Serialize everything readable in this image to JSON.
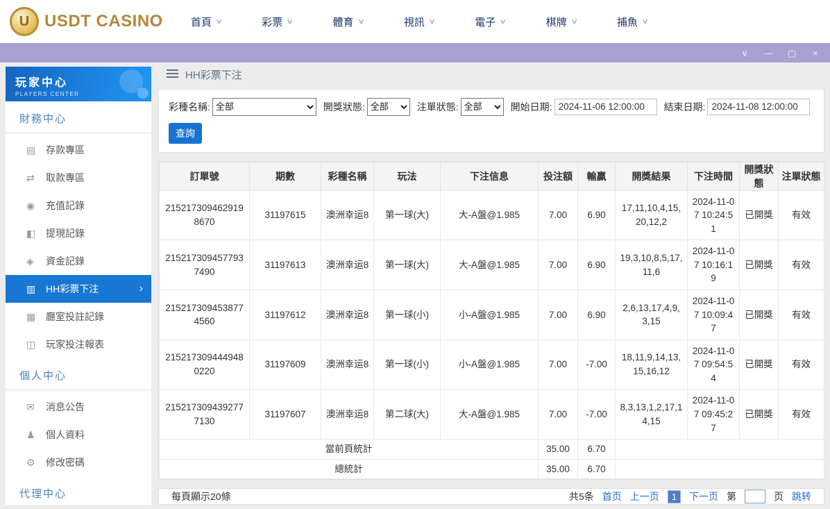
{
  "app": {
    "logo_text": "USDT CASINO",
    "logo_monogram": "U"
  },
  "nav": {
    "items": [
      {
        "label": "首頁"
      },
      {
        "label": "彩票"
      },
      {
        "label": "體育"
      },
      {
        "label": "視訊"
      },
      {
        "label": "電子"
      },
      {
        "label": "棋牌"
      },
      {
        "label": "捕魚"
      }
    ]
  },
  "window_controls": {
    "chevron": "∨",
    "minimize": "—",
    "maximize": "▢",
    "close": "×"
  },
  "icons": {
    "nav_chevron": "∨",
    "active_chevron": "›"
  },
  "colors": {
    "accent_blue": "#1673d2",
    "titlebar_purple": "#a7a1d1",
    "sidebar_header_blue": "#1e88e5",
    "link_blue": "#2b6cd4"
  },
  "sidebar": {
    "title": "玩家中心",
    "subtitle": "PLAYERS CENTER",
    "sections": [
      {
        "heading": "財務中心",
        "items": [
          {
            "label": "存款專區",
            "icon": "▤"
          },
          {
            "label": "取款專區",
            "icon": "⇄"
          },
          {
            "label": "充值記錄",
            "icon": "◉"
          },
          {
            "label": "提現記錄",
            "icon": "◧"
          },
          {
            "label": "資金記錄",
            "icon": "◈"
          },
          {
            "label": "HH彩票下注",
            "icon": "▥"
          },
          {
            "label": "廳室投註記錄",
            "icon": "▦"
          },
          {
            "label": "玩家投注報表",
            "icon": "◫"
          }
        ]
      },
      {
        "heading": "個人中心",
        "items": [
          {
            "label": "消息公告",
            "icon": "✉"
          },
          {
            "label": "個人資料",
            "icon": "♟"
          },
          {
            "label": "修改密碼",
            "icon": "⚙"
          }
        ]
      },
      {
        "heading": "代理中心",
        "items": []
      }
    ]
  },
  "breadcrumb": {
    "title": "HH彩票下注"
  },
  "filters": {
    "lottery_name": {
      "label": "彩種名稱:",
      "value": "全部"
    },
    "draw_status": {
      "label": "開獎狀態:",
      "value": "全部"
    },
    "order_status": {
      "label": "注單狀態:",
      "value": "全部"
    },
    "start_date": {
      "label": "開始日期:",
      "value": "2024-11-06 12:00:00"
    },
    "end_date": {
      "label": "結束日期:",
      "value": "2024-11-08 12:00:00"
    },
    "search_button": "查詢"
  },
  "table": {
    "headers": [
      "訂單號",
      "期數",
      "彩種名稱",
      "玩法",
      "下注信息",
      "投注額",
      "輸贏",
      "開獎結果",
      "下注時間",
      "開獎狀態",
      "注單狀態"
    ],
    "rows": [
      [
        "2152173094629198670",
        "31197615",
        "澳洲幸运8",
        "第一球(大)",
        "大-A盤@1.985",
        "7.00",
        "6.90",
        "17,11,10,4,15,20,12,2",
        "2024-11-07 10:24:51",
        "已開獎",
        "有效"
      ],
      [
        "2152173094577937490",
        "31197613",
        "澳洲幸运8",
        "第一球(大)",
        "大-A盤@1.985",
        "7.00",
        "6.90",
        "19,3,10,8,5,17,11,6",
        "2024-11-07 10:16:19",
        "已開獎",
        "有效"
      ],
      [
        "2152173094538774560",
        "31197612",
        "澳洲幸运8",
        "第一球(小)",
        "小-A盤@1.985",
        "7.00",
        "6.90",
        "2,6,13,17,4,9,3,15",
        "2024-11-07 10:09:47",
        "已開獎",
        "有效"
      ],
      [
        "2152173094449480220",
        "31197609",
        "澳洲幸运8",
        "第一球(小)",
        "小-A盤@1.985",
        "7.00",
        "-7.00",
        "18,11,9,14,13,15,16,12",
        "2024-11-07 09:54:54",
        "已開獎",
        "有效"
      ],
      [
        "2152173094392777130",
        "31197607",
        "澳洲幸运8",
        "第二球(大)",
        "大-A盤@1.985",
        "7.00",
        "-7.00",
        "8,3,13,1,2,17,14,15",
        "2024-11-07 09:45:27",
        "已開獎",
        "有效"
      ]
    ],
    "summary_rows": [
      {
        "label": "當前頁統計",
        "bet": "35.00",
        "winloss": "6.70"
      },
      {
        "label": "總統計",
        "bet": "35.00",
        "winloss": "6.70"
      }
    ]
  },
  "pagination": {
    "page_size_text": "每頁顯示20條",
    "total_text": "共5条",
    "first": "首页",
    "prev": "上一页",
    "current_page": "1",
    "next": "下一页",
    "jump_prefix": "第",
    "jump_suffix": "页",
    "jump_button": "跳转"
  }
}
